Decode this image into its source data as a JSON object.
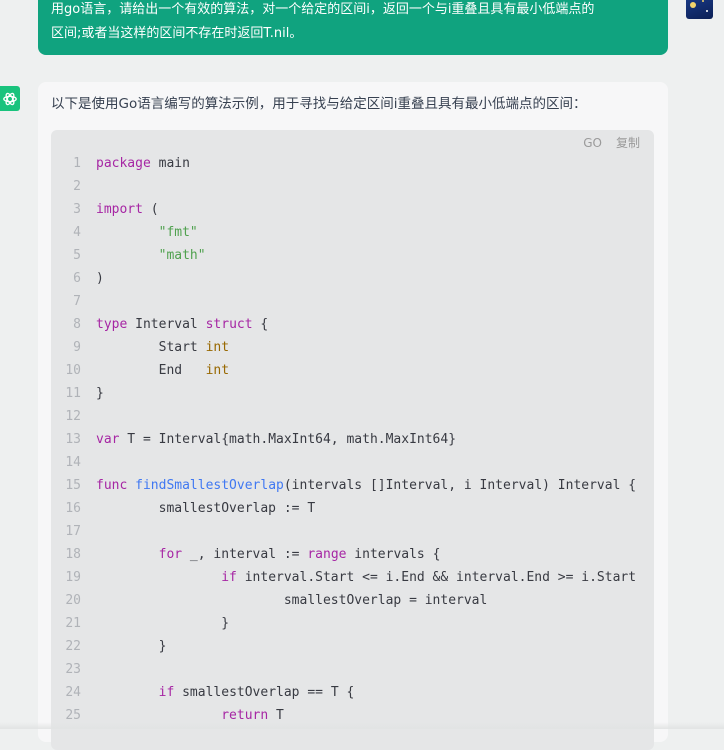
{
  "user_message": {
    "line1": "用go语言，请给出一个有效的算法，对一个给定的区间i，返回一个与i重叠且具有最小低端点的",
    "line2": "区间;或者当这样的区间不存在时返回T.nil。"
  },
  "assistant": {
    "intro": "以下是使用Go语言编写的算法示例，用于寻找与给定区间i重叠且具有最小低端点的区间："
  },
  "code_block": {
    "language": "GO",
    "copy_label": "复制",
    "lines": [
      {
        "n": "1",
        "tokens": [
          {
            "t": "package",
            "c": "kw"
          },
          {
            "t": " main",
            "c": ""
          }
        ]
      },
      {
        "n": "2",
        "tokens": []
      },
      {
        "n": "3",
        "tokens": [
          {
            "t": "import",
            "c": "kw"
          },
          {
            "t": " (",
            "c": ""
          }
        ]
      },
      {
        "n": "4",
        "tokens": [
          {
            "t": "        ",
            "c": ""
          },
          {
            "t": "\"fmt\"",
            "c": "st"
          }
        ]
      },
      {
        "n": "5",
        "tokens": [
          {
            "t": "        ",
            "c": ""
          },
          {
            "t": "\"math\"",
            "c": "st"
          }
        ]
      },
      {
        "n": "6",
        "tokens": [
          {
            "t": ")",
            "c": ""
          }
        ]
      },
      {
        "n": "7",
        "tokens": []
      },
      {
        "n": "8",
        "tokens": [
          {
            "t": "type",
            "c": "kw"
          },
          {
            "t": " Interval ",
            "c": ""
          },
          {
            "t": "struct",
            "c": "kw"
          },
          {
            "t": " {",
            "c": ""
          }
        ]
      },
      {
        "n": "9",
        "tokens": [
          {
            "t": "        Start ",
            "c": ""
          },
          {
            "t": "int",
            "c": "ty"
          }
        ]
      },
      {
        "n": "10",
        "tokens": [
          {
            "t": "        End   ",
            "c": ""
          },
          {
            "t": "int",
            "c": "ty"
          }
        ]
      },
      {
        "n": "11",
        "tokens": [
          {
            "t": "}",
            "c": ""
          }
        ]
      },
      {
        "n": "12",
        "tokens": []
      },
      {
        "n": "13",
        "tokens": [
          {
            "t": "var",
            "c": "kw"
          },
          {
            "t": " T = Interval{math.MaxInt64, math.MaxInt64}",
            "c": ""
          }
        ]
      },
      {
        "n": "14",
        "tokens": []
      },
      {
        "n": "15",
        "tokens": [
          {
            "t": "func",
            "c": "kw"
          },
          {
            "t": " ",
            "c": ""
          },
          {
            "t": "findSmallestOverlap",
            "c": "fn"
          },
          {
            "t": "(intervals []Interval, i Interval) Interval {",
            "c": ""
          }
        ]
      },
      {
        "n": "16",
        "tokens": [
          {
            "t": "        smallestOverlap := T",
            "c": ""
          }
        ]
      },
      {
        "n": "17",
        "tokens": []
      },
      {
        "n": "18",
        "tokens": [
          {
            "t": "        ",
            "c": ""
          },
          {
            "t": "for",
            "c": "kw"
          },
          {
            "t": " _, interval := ",
            "c": ""
          },
          {
            "t": "range",
            "c": "kw"
          },
          {
            "t": " intervals {",
            "c": ""
          }
        ]
      },
      {
        "n": "19",
        "tokens": [
          {
            "t": "                ",
            "c": ""
          },
          {
            "t": "if",
            "c": "kw"
          },
          {
            "t": " interval.Start <= i.End && interval.End >= i.Start",
            "c": ""
          }
        ]
      },
      {
        "n": "20",
        "tokens": [
          {
            "t": "                        smallestOverlap = interval",
            "c": ""
          }
        ]
      },
      {
        "n": "21",
        "tokens": [
          {
            "t": "                }",
            "c": ""
          }
        ]
      },
      {
        "n": "22",
        "tokens": [
          {
            "t": "        }",
            "c": ""
          }
        ]
      },
      {
        "n": "23",
        "tokens": []
      },
      {
        "n": "24",
        "tokens": [
          {
            "t": "        ",
            "c": ""
          },
          {
            "t": "if",
            "c": "kw"
          },
          {
            "t": " smallestOverlap == T {",
            "c": ""
          }
        ]
      },
      {
        "n": "25",
        "tokens": [
          {
            "t": "                ",
            "c": ""
          },
          {
            "t": "return",
            "c": "kw"
          },
          {
            "t": " T",
            "c": ""
          }
        ]
      }
    ]
  }
}
